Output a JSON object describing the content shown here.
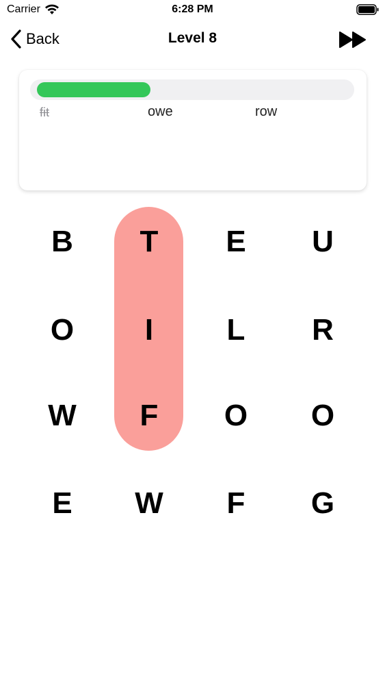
{
  "status_bar": {
    "carrier": "Carrier",
    "time": "6:28 PM",
    "wifi_icon": "wifi-icon",
    "battery_icon": "battery-icon"
  },
  "nav": {
    "back_label": "Back",
    "title": "Level 8",
    "skip_icon": "fast-forward-icon"
  },
  "progress": {
    "fraction": 0.36,
    "color": "#34c759"
  },
  "words": [
    {
      "text": "fit",
      "found": true
    },
    {
      "text": "owe",
      "found": false
    },
    {
      "text": "row",
      "found": false
    }
  ],
  "grid": {
    "rows": [
      [
        "B",
        "T",
        "E",
        "U"
      ],
      [
        "O",
        "I",
        "L",
        "R"
      ],
      [
        "W",
        "F",
        "O",
        "O"
      ],
      [
        "E",
        "W",
        "F",
        "G"
      ]
    ],
    "selection_color": "#fa9f9a"
  }
}
